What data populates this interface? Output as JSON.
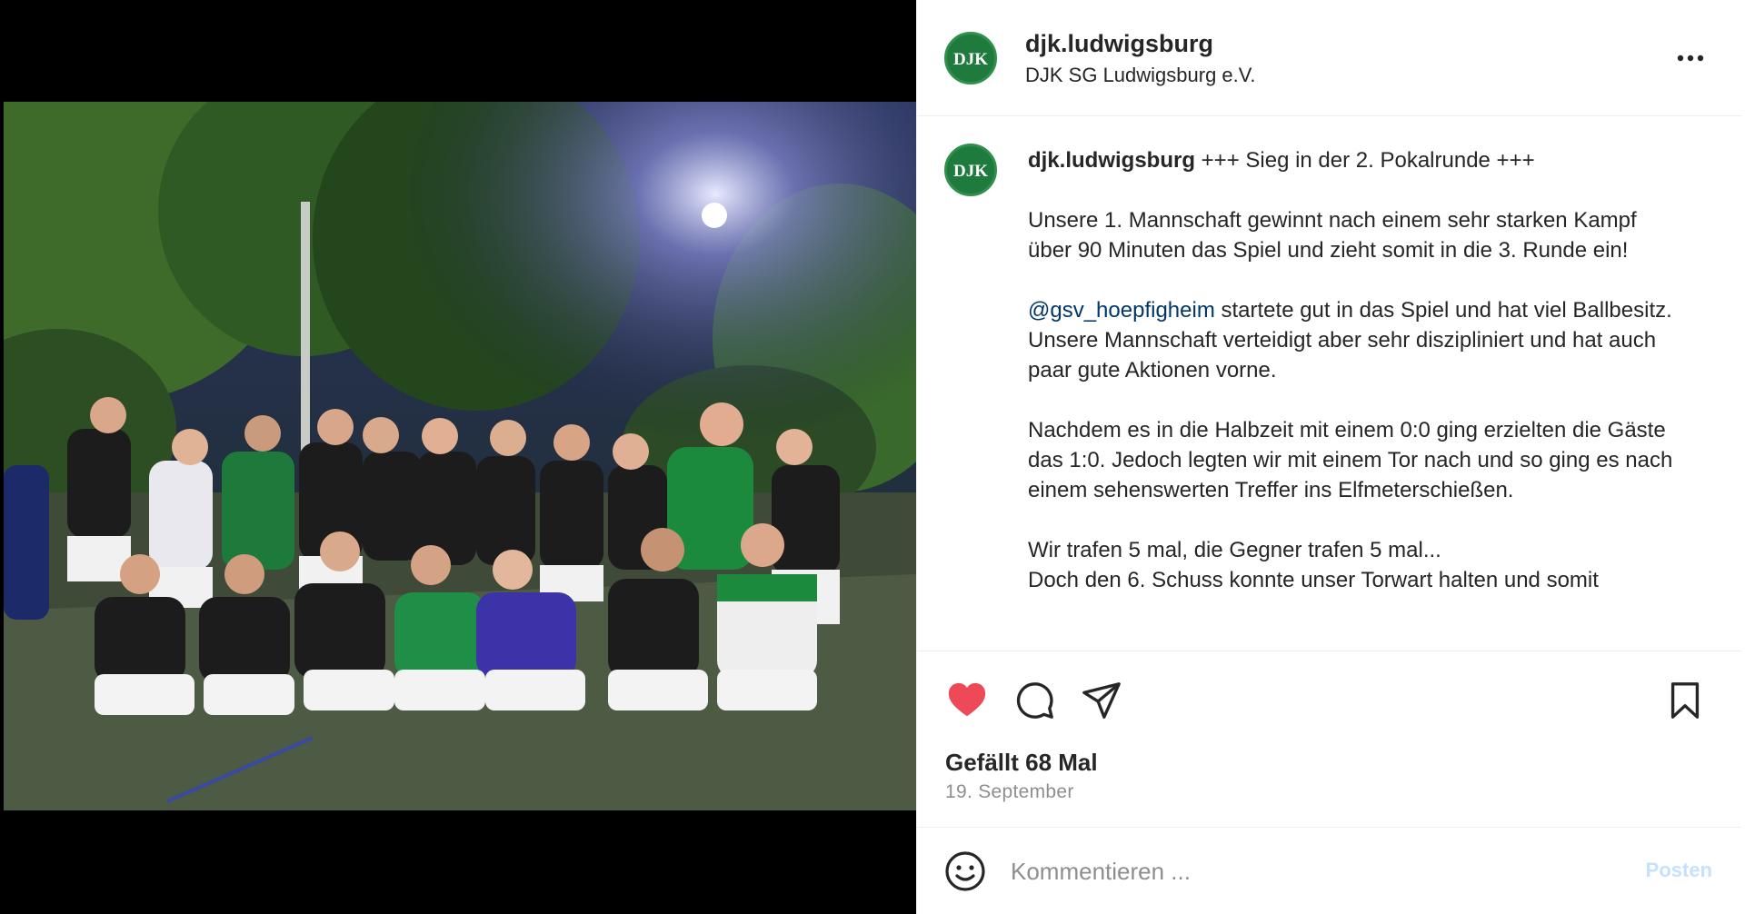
{
  "colors": {
    "like_red": "#ed4956",
    "link_blue": "#00376b",
    "post_button_disabled": "#c7e1fc",
    "muted_text": "#8e8e8e",
    "brand_green": "#1f7a3d"
  },
  "header": {
    "avatar_text": "DJK",
    "username": "djk.ludwigsburg",
    "subtitle": "DJK SG Ludwigsburg e.V.",
    "more_icon": "more-horizontal-icon"
  },
  "caption": {
    "username": "djk.ludwigsburg",
    "intro": " +++ Sieg in der 2. Pokalrunde +++\n\nUnsere 1. Mannschaft gewinnt nach einem sehr starken Kampf über 90 Minuten das Spiel und zieht somit in die 3. Runde ein!\n\n",
    "mention": "@gsv_hoepfigheim",
    "body": " startete gut in das Spiel und hat viel Ballbesitz. Unsere Mannschaft verteidigt aber sehr diszipliniert und hat auch paar gute Aktionen vorne.\n\nNachdem es in die Halbzeit mit einem 0:0 ging erzielten die Gäste das 1:0. Jedoch legten wir mit einem Tor nach und so ging es nach einem sehenswerten Treffer ins Elfmeterschießen.\n\nWir trafen 5 mal, die Gegner trafen 5 mal...\nDoch den 6. Schuss konnte unser Torwart halten und somit"
  },
  "actions": {
    "like_icon": "heart-filled-icon",
    "comment_icon": "comment-icon",
    "share_icon": "send-icon",
    "save_icon": "bookmark-icon",
    "liked": true
  },
  "likes_text": "Gefällt 68 Mal",
  "date_text": "19. September",
  "comment_bar": {
    "emoji_icon": "emoji-icon",
    "placeholder": "Kommentieren ...",
    "post_label": "Posten"
  }
}
